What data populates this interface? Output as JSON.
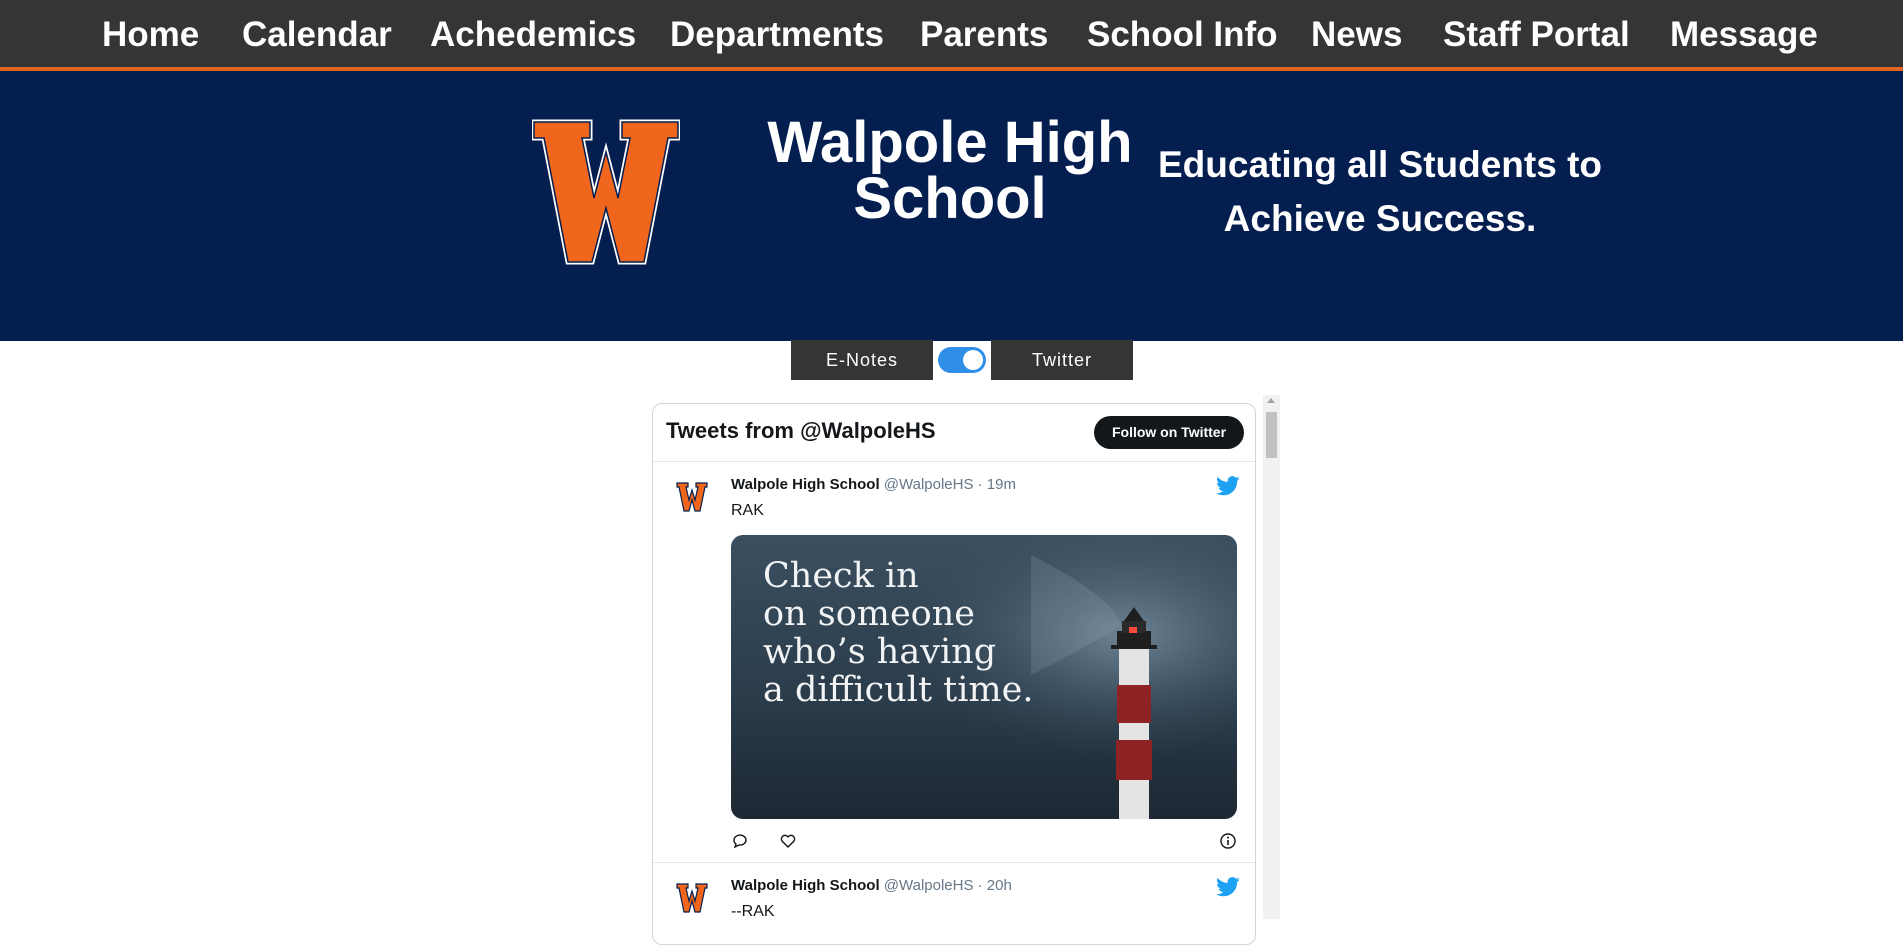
{
  "nav": {
    "items": [
      "Home",
      "Calendar",
      "Achedemics",
      "Departments",
      "Parents",
      "School Info",
      "News",
      "Staff Portal",
      "Message"
    ]
  },
  "hero": {
    "logo_letter": "W",
    "school_name": "Walpole High School",
    "tagline": "Educating all Students to Achieve Success."
  },
  "toggle": {
    "left_label": "E-Notes",
    "right_label": "Twitter",
    "state": "on"
  },
  "widget": {
    "title": "Tweets from @WalpoleHS",
    "follow_label": "Follow on Twitter",
    "tweets": [
      {
        "name": "Walpole High School",
        "meta": "@WalpoleHS · 19m",
        "text": "RAK",
        "media_text": "Check in\non someone\nwho’s having\na difficult time."
      },
      {
        "name": "Walpole High School",
        "meta": "@WalpoleHS · 20h",
        "text": "--RAK"
      }
    ]
  },
  "colors": {
    "nav_bg": "#353535",
    "accent_orange": "#e2641f",
    "hero_navy": "#041e4f",
    "logo_orange": "#f0661d",
    "toggle_blue": "#2f8fe6",
    "twitter_blue": "#1da1f2"
  },
  "icons": [
    "w-logo",
    "twitter-bird-icon",
    "reply-icon",
    "like-icon",
    "info-icon",
    "scroll-up-arrow-icon"
  ]
}
